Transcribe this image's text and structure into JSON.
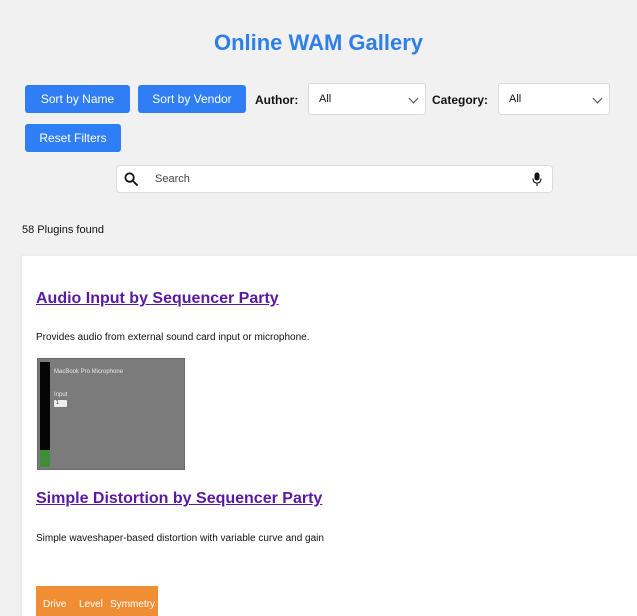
{
  "header": {
    "title": "Online WAM Gallery"
  },
  "controls": {
    "sort_by_name": "Sort by Name",
    "sort_by_vendor": "Sort by Vendor",
    "author_label": "Author:",
    "author_value": "All",
    "category_label": "Category:",
    "category_value": "All",
    "reset_filters": "Reset Filters"
  },
  "search": {
    "placeholder": "Search",
    "value": ""
  },
  "results": {
    "count_text": "58 Plugins found"
  },
  "plugins": [
    {
      "title": "Audio Input by Sequencer Party",
      "description": "Provides audio from external sound card input or microphone.",
      "thumbnail": {
        "device_name": "MacBook Pro Microphone",
        "input_label": "Input",
        "input_value": "1",
        "meter_level": 0.16,
        "colors": {
          "background": "#7b7b7b",
          "meter": "#050505",
          "meter_fill": "#3f8d37"
        }
      }
    },
    {
      "title": "Simple Distortion by Sequencer Party",
      "description": "Simple waveshaper-based distortion with variable curve and gain",
      "thumbnail": {
        "knob_labels": [
          "Drive",
          "Level",
          "Symmetry"
        ],
        "colors": {
          "background": "#f08e35",
          "knob": "#111111"
        }
      }
    }
  ],
  "colors": {
    "accent": "#2f7ef5",
    "title": "#2f7fe8",
    "link": "#5a1aa0",
    "background": "#f1f1f1"
  },
  "icons": {
    "search": "search-icon",
    "mic": "microphone-icon",
    "chevron": "chevron-down-icon"
  }
}
